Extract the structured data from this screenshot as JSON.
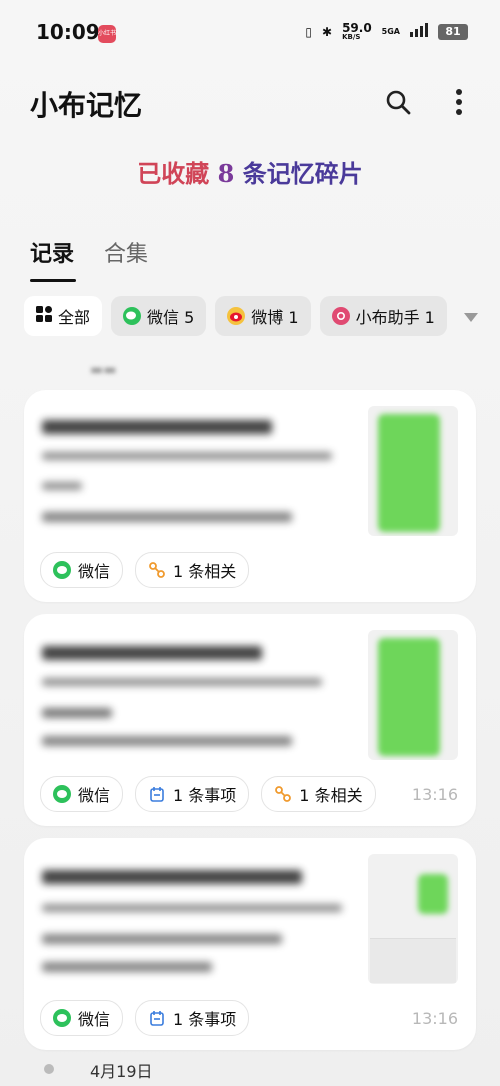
{
  "status_bar": {
    "time": "10:09",
    "app_badge": "小红书",
    "net_speed": "59.0",
    "net_unit": "KB/S",
    "network": "5GA",
    "battery": "81"
  },
  "header": {
    "title": "小布记忆",
    "search_icon": "search-icon",
    "more_icon": "more-vertical-icon"
  },
  "collect_summary": {
    "prefix": "已收藏",
    "count": "8",
    "suffix": "条记忆碎片"
  },
  "tabs": [
    {
      "label": "记录",
      "active": true
    },
    {
      "label": "合集",
      "active": false
    }
  ],
  "filters": [
    {
      "label": "全部",
      "icon": "grid-icon"
    },
    {
      "label": "微信 5",
      "icon": "wechat-icon"
    },
    {
      "label": "微博 1",
      "icon": "weibo-icon"
    },
    {
      "label": "小布助手 1",
      "icon": "assistant-icon"
    }
  ],
  "cards": [
    {
      "tags": [
        {
          "label": "微信",
          "icon": "wechat-icon"
        },
        {
          "label": "1 条相关",
          "icon": "link-icon"
        }
      ],
      "time": ""
    },
    {
      "tags": [
        {
          "label": "微信",
          "icon": "wechat-icon"
        },
        {
          "label": "1 条事项",
          "icon": "calendar-icon"
        },
        {
          "label": "1 条相关",
          "icon": "link-icon"
        }
      ],
      "time": "13:16"
    },
    {
      "tags": [
        {
          "label": "微信",
          "icon": "wechat-icon"
        },
        {
          "label": "1 条事项",
          "icon": "calendar-icon"
        }
      ],
      "time": "13:16"
    }
  ],
  "next_date": "4月19日",
  "colors": {
    "wechat": "#2dc15b",
    "link_orange": "#f09a2e",
    "calendar_blue": "#3b7ddd",
    "assistant_pink": "#e04a72"
  }
}
